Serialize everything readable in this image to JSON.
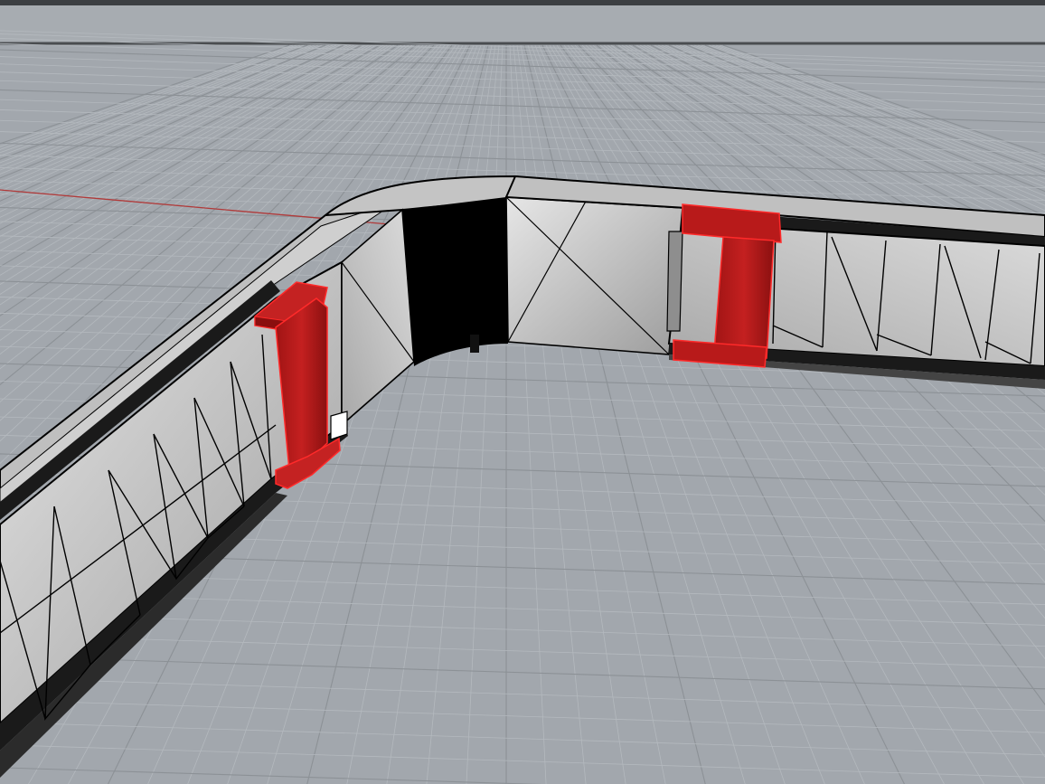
{
  "viewport": {
    "projection": "perspective",
    "background_color": "#a2a7ad",
    "grid": {
      "minor_color": "#b4b9be",
      "major_color": "#8c9196",
      "x_axis_color": "#b03a3a"
    },
    "model": {
      "wireframe_color": "#000000",
      "face_color": "#d2d2d2"
    },
    "selection": {
      "highlight_color": "#c41818",
      "selected_objects": 2
    }
  }
}
